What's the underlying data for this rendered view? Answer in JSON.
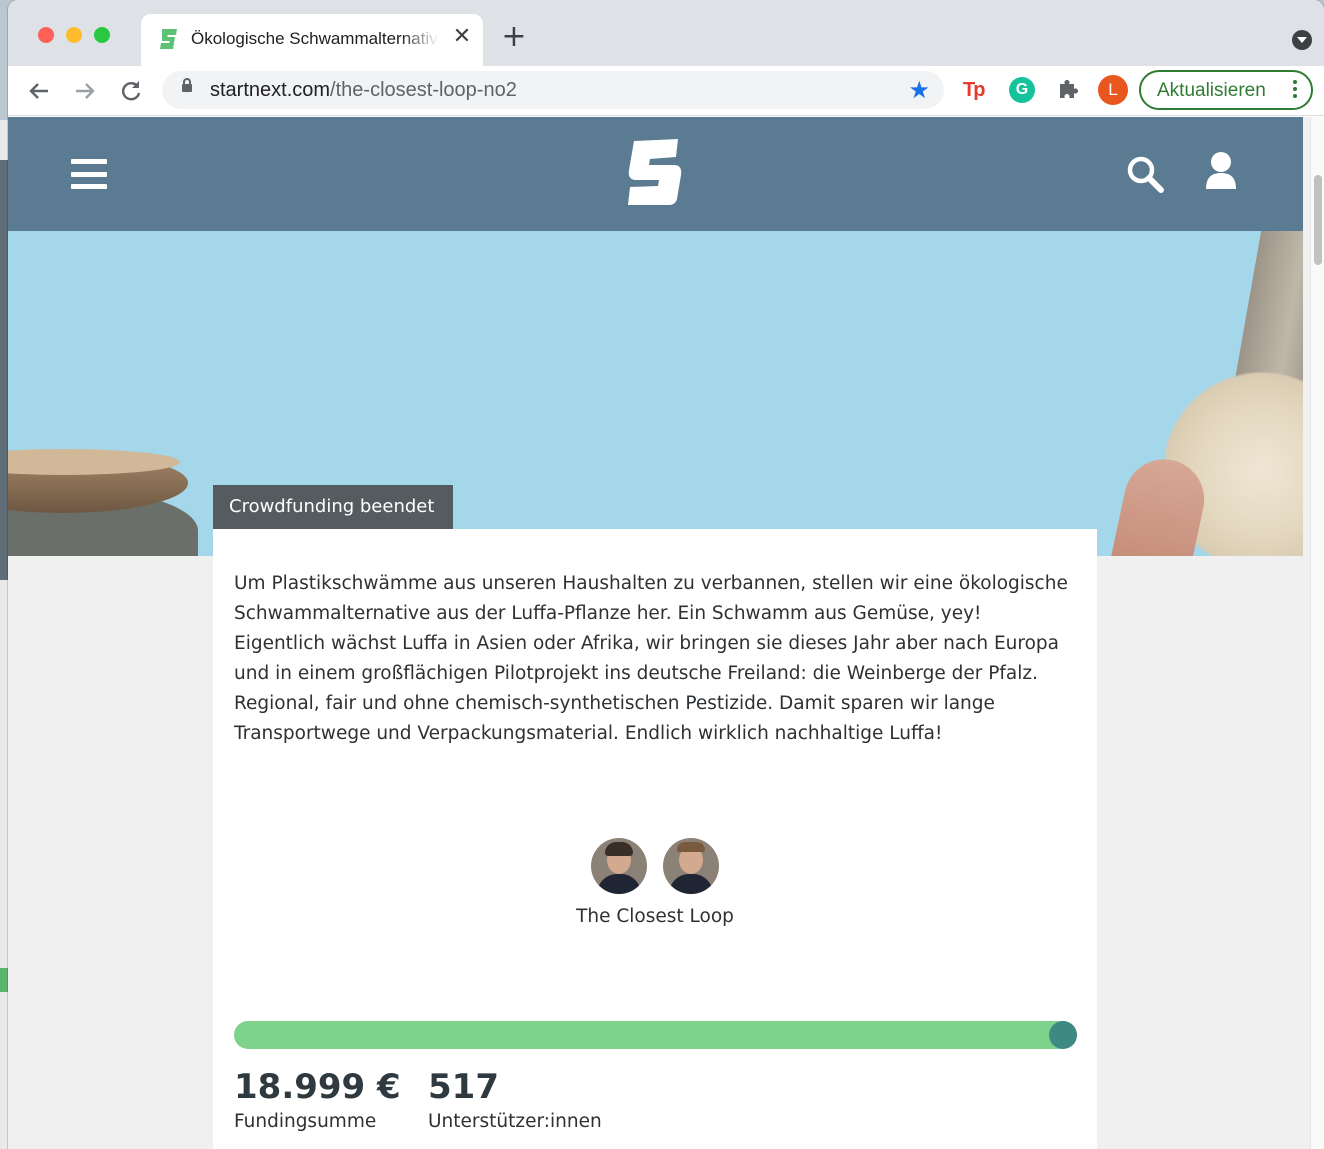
{
  "browser": {
    "tab_title": "Ökologische Schwammalternative",
    "tab_close": "✕",
    "new_tab": "+",
    "url_host": "startnext.com",
    "url_path": "/the-closest-loop-no2",
    "profile_initial": "L",
    "update_button": "Aktualisieren",
    "extensions": [
      "tp-icon",
      "grammarly-icon",
      "puzzle-icon"
    ],
    "ext_tp_label": "Tp",
    "ext_g_label": "G"
  },
  "site": {
    "brand_color": "#5a7b91"
  },
  "project": {
    "status_badge": "Crowdfunding beendet",
    "description_lines": [
      "Um Plastikschwämme aus unseren Haushalten zu verbannen, stellen wir eine ökologische",
      "Schwammalternative aus der Luffa-Pflanze her. Ein Schwamm aus Gemüse, yey!",
      "Eigentlich wächst Luffa in Asien oder Afrika, wir bringen sie dieses Jahr aber nach Europa",
      "und in einem großflächigen Pilotprojekt ins deutsche Freiland: die Weinberge der Pfalz.",
      "Regional, fair und ohne chemisch-synthetischen Pestizide. Damit sparen wir lange",
      "Transportwege und Verpackungsmaterial. Endlich wirklich nachhaltige Luffa!"
    ],
    "creator_name": "The Closest Loop",
    "funding_progress": 1.0,
    "progress_color": "#7ed28b",
    "funding_amount": "18.999 €",
    "funding_label": "Fundingsumme",
    "supporters_count": "517",
    "supporters_label": "Unterstützer:innen"
  }
}
